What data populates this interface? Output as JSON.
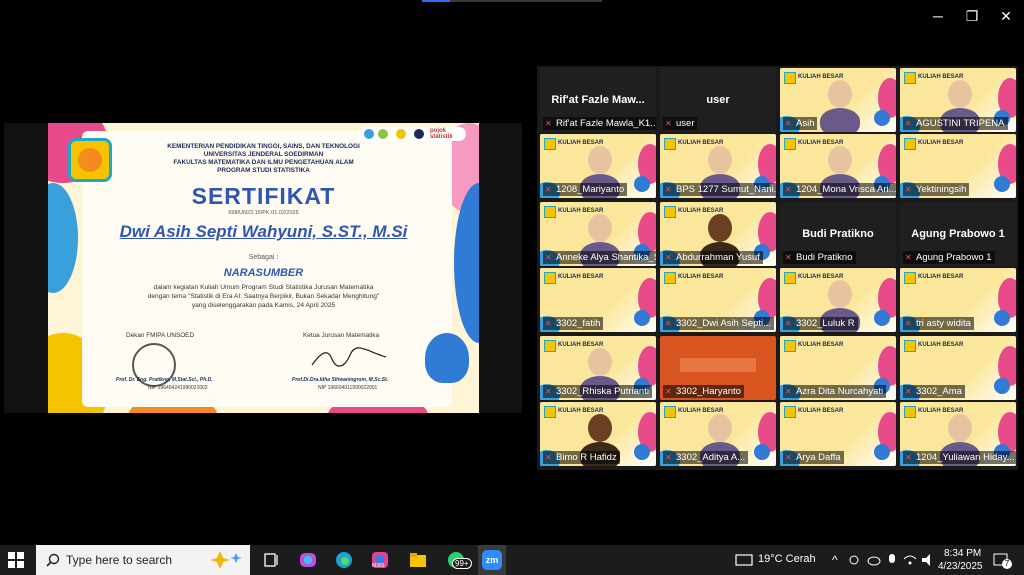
{
  "window": {
    "minimize_glyph": "─",
    "maximize_glyph": "❐",
    "close_glyph": "✕"
  },
  "certificate": {
    "ministry": "KEMENTERIAN PENDIDIKAN TINGGI, SAINS, DAN TEKNOLOGI",
    "university": "UNIVERSITAS JENDERAL SOEDIRMAN",
    "faculty": "FAKULTAS MATEMATIKA DAN ILMU PENGETAHUAN ALAM",
    "program": "PROGRAM STUDI STATISTIKA",
    "title": "SERTIFIKAT",
    "number": "698/UN23.15/PK.01.02/2025",
    "recipient": "Dwi Asih Septi Wahyuni, S.ST., M.Si",
    "as_label": "Sebagai :",
    "role": "NARASUMBER",
    "desc1": "dalam kegiatan Kuliah Umum Program Studi Statistika Jurusan Matematika",
    "desc2": "dengan tema \"Statistik di Era AI: Saatnya Berpikir, Bukan Sekadar Menghitung\"",
    "desc3": "yang diselenggarakan pada Kamis, 24 April 2025",
    "sign_left_title": "Dekan FMIPA UNSOED",
    "sign_left_name": "Prof. Dr. Eng. Pratikno, M.Stat.Sci., Ph.D.",
    "sign_left_nip": "NIP 196404241990021002",
    "sign_right_title": "Ketua Jurusan Matematika",
    "sign_right_name": "Prof.Dr.Dra.Idha Sihwaningrum, M.Sc.St.",
    "sign_right_nip": "NIP 196604011990022001",
    "partner_logo": "pojok statistik"
  },
  "gallery": {
    "banner": "KULIAH BESAR",
    "tiles": [
      {
        "label": "Rif'at Fazle Mawla_K1...",
        "name": "Rif'at Fazle Maw...",
        "type": "dark"
      },
      {
        "label": "user",
        "name": "user",
        "type": "dark"
      },
      {
        "label": "Asih",
        "type": "video"
      },
      {
        "label": "AGUSTINI TRIPENA",
        "type": "video"
      },
      {
        "label": "1208_Mariyanto",
        "type": "video",
        "active": true
      },
      {
        "label": "BPS 1277 Sumut_Nani...",
        "type": "video"
      },
      {
        "label": "1204_Mona Vrisca Ari...",
        "type": "video"
      },
      {
        "label": "Yektiningsih",
        "type": "banner"
      },
      {
        "label": "Anneke Alya Shantika_St...",
        "type": "video"
      },
      {
        "label": "Abdurrahman Yusuf",
        "type": "avatar"
      },
      {
        "label": "Budi Pratikno",
        "name": "Budi Pratikno",
        "type": "dark"
      },
      {
        "label": "Agung Prabowo 1",
        "name": "Agung Prabowo 1",
        "type": "dark"
      },
      {
        "label": "3302_fatih",
        "type": "banner"
      },
      {
        "label": "3302_Dwi Asih Septi...",
        "type": "banner"
      },
      {
        "label": "3302_Luluk R",
        "type": "video"
      },
      {
        "label": "tri asty widita",
        "type": "banner"
      },
      {
        "label": "3302_Rhiska Putrianti",
        "type": "video"
      },
      {
        "label": "3302_Haryanto",
        "type": "orange"
      },
      {
        "label": "Azra Dita Nurcahyati",
        "type": "banner"
      },
      {
        "label": "3302_Ama",
        "type": "banner"
      },
      {
        "label": "Bimo R Hafidz",
        "type": "avatar"
      },
      {
        "label": "3302_Aditya A...",
        "type": "video"
      },
      {
        "label": "Arya Daffa",
        "type": "banner"
      },
      {
        "label": "1204_Yuliawan Hiday...",
        "type": "video"
      }
    ]
  },
  "taskbar": {
    "search_placeholder": "Type here to search",
    "weather": "19°C  Cerah",
    "time": "8:34 PM",
    "date": "4/23/2025",
    "whatsapp_badge": "99+",
    "m365_label": "M365",
    "zoom_label": "zm",
    "notification_count": "7"
  },
  "colors": {
    "taskbar": "#1c1c1c",
    "active_speaker": "#2ecc71",
    "cert_navy": "#1b2a59",
    "cert_blue": "#2f55b5"
  }
}
